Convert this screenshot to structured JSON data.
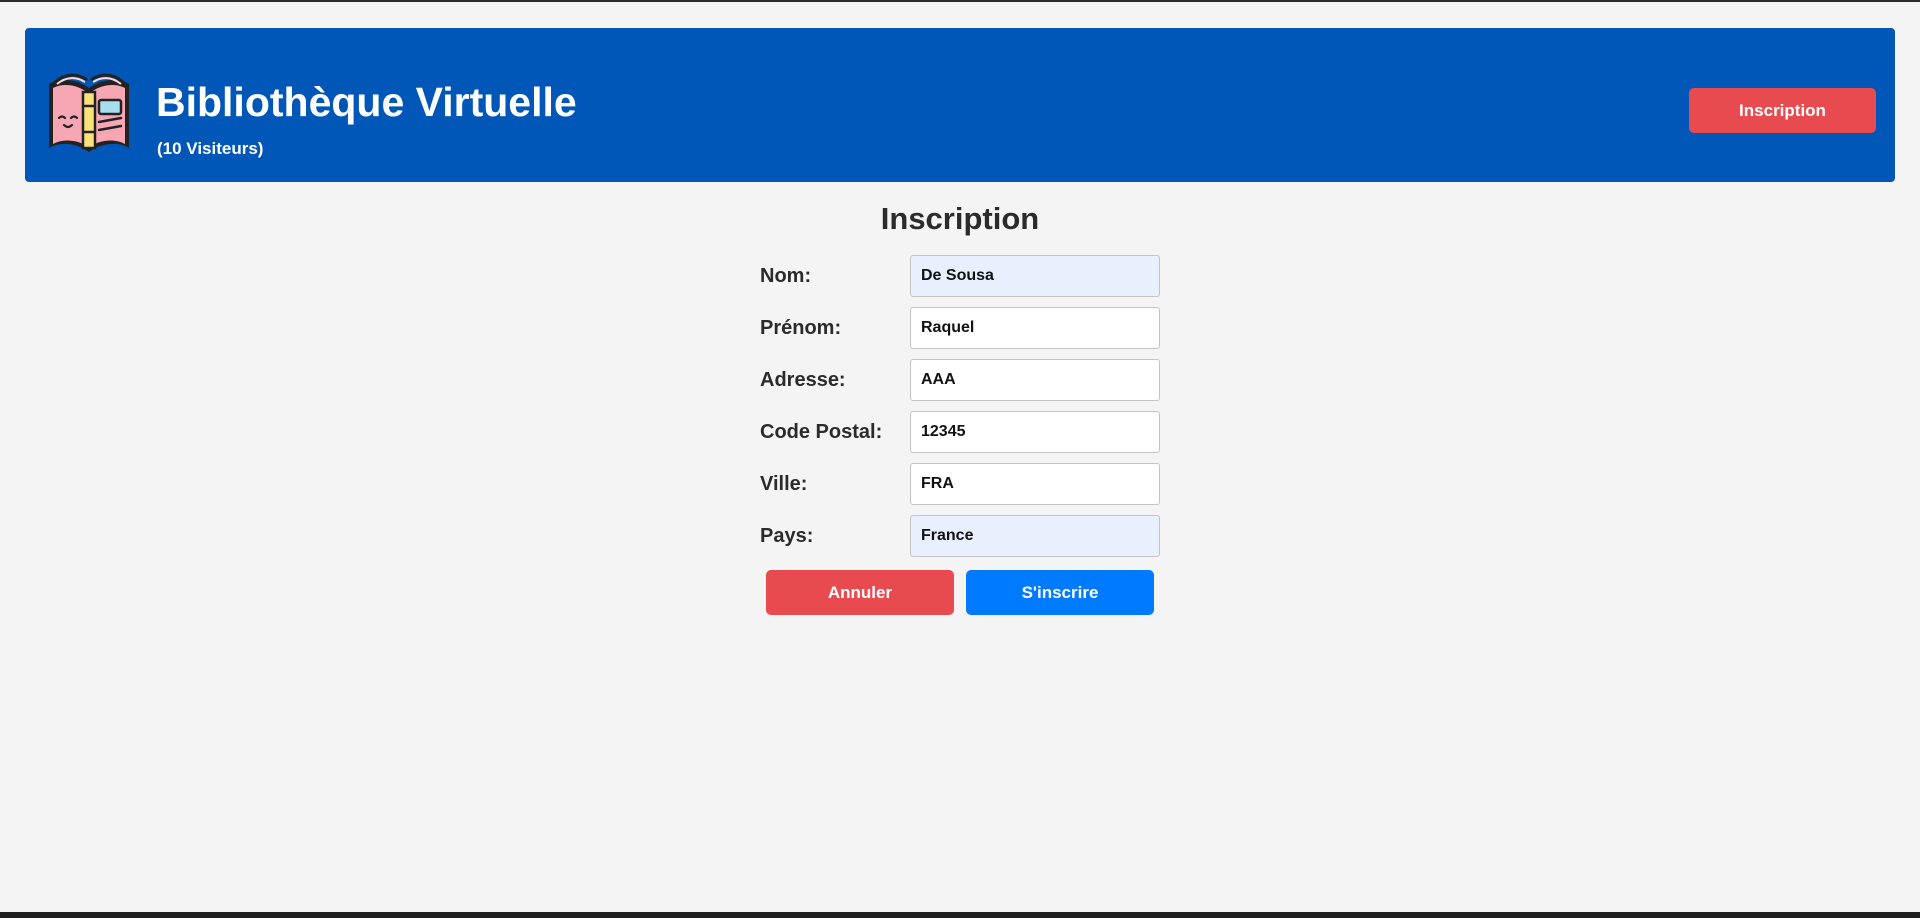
{
  "header": {
    "title": "Bibliothèque Virtuelle",
    "visitors": "(10 Visiteurs)",
    "register_button": "Inscription",
    "logo_icon": "open-book-icon"
  },
  "form": {
    "title": "Inscription",
    "fields": [
      {
        "label": "Nom:",
        "value": "De Sousa",
        "autofilled": true
      },
      {
        "label": "Prénom:",
        "value": "Raquel",
        "autofilled": false
      },
      {
        "label": "Adresse:",
        "value": "AAA",
        "autofilled": false
      },
      {
        "label": "Code Postal:",
        "value": "12345",
        "autofilled": false
      },
      {
        "label": "Ville:",
        "value": "FRA",
        "autofilled": false
      },
      {
        "label": "Pays:",
        "value": "France",
        "autofilled": true
      }
    ],
    "cancel_button": "Annuler",
    "submit_button": "S'inscrire"
  },
  "colors": {
    "header_bg": "#0057b8",
    "danger": "#e84b4f",
    "primary": "#007bff",
    "page_bg": "#f4f4f4",
    "autofill_bg": "#e8f0fe"
  }
}
